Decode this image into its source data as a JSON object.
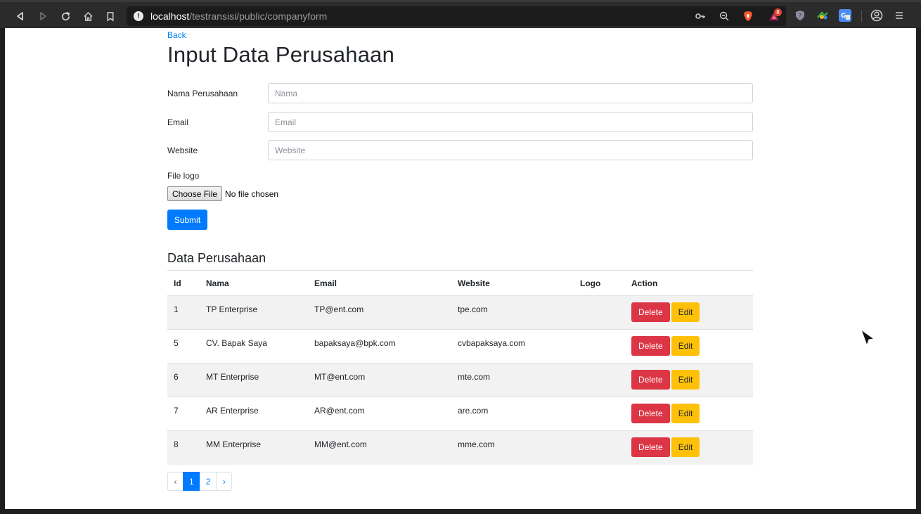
{
  "browser": {
    "url_host": "localhost",
    "url_path": "/testransisi/public/companyform",
    "extension_badge": "8"
  },
  "page": {
    "back_link": "Back",
    "title": "Input Data Perusahaan",
    "form": {
      "name_label": "Nama Perusahaan",
      "name_placeholder": "Nama",
      "email_label": "Email",
      "email_placeholder": "Email",
      "website_label": "Website",
      "website_placeholder": "Website",
      "file_label": "File logo",
      "file_button": "Choose File",
      "file_status": "No file chosen",
      "submit_label": "Submit"
    },
    "table_section": {
      "title": "Data Perusahaan",
      "headers": [
        "Id",
        "Nama",
        "Email",
        "Website",
        "Logo",
        "Action"
      ],
      "rows": [
        {
          "id": "1",
          "nama": "TP Enterprise",
          "email": "TP@ent.com",
          "website": "tpe.com",
          "logo": ""
        },
        {
          "id": "5",
          "nama": "CV. Bapak Saya",
          "email": "bapaksaya@bpk.com",
          "website": "cvbapaksaya.com",
          "logo": ""
        },
        {
          "id": "6",
          "nama": "MT Enterprise",
          "email": "MT@ent.com",
          "website": "mte.com",
          "logo": ""
        },
        {
          "id": "7",
          "nama": "AR Enterprise",
          "email": "AR@ent.com",
          "website": "are.com",
          "logo": ""
        },
        {
          "id": "8",
          "nama": "MM Enterprise",
          "email": "MM@ent.com",
          "website": "mme.com",
          "logo": ""
        }
      ],
      "delete_label": "Delete",
      "edit_label": "Edit"
    },
    "pagination": {
      "prev": "‹",
      "pages": [
        "1",
        "2"
      ],
      "active_page": "1",
      "next": "›"
    }
  },
  "colors": {
    "primary": "#007bff",
    "danger": "#dc3545",
    "warning": "#ffc107",
    "text": "#212529",
    "striped_row": "#f2f2f2"
  }
}
